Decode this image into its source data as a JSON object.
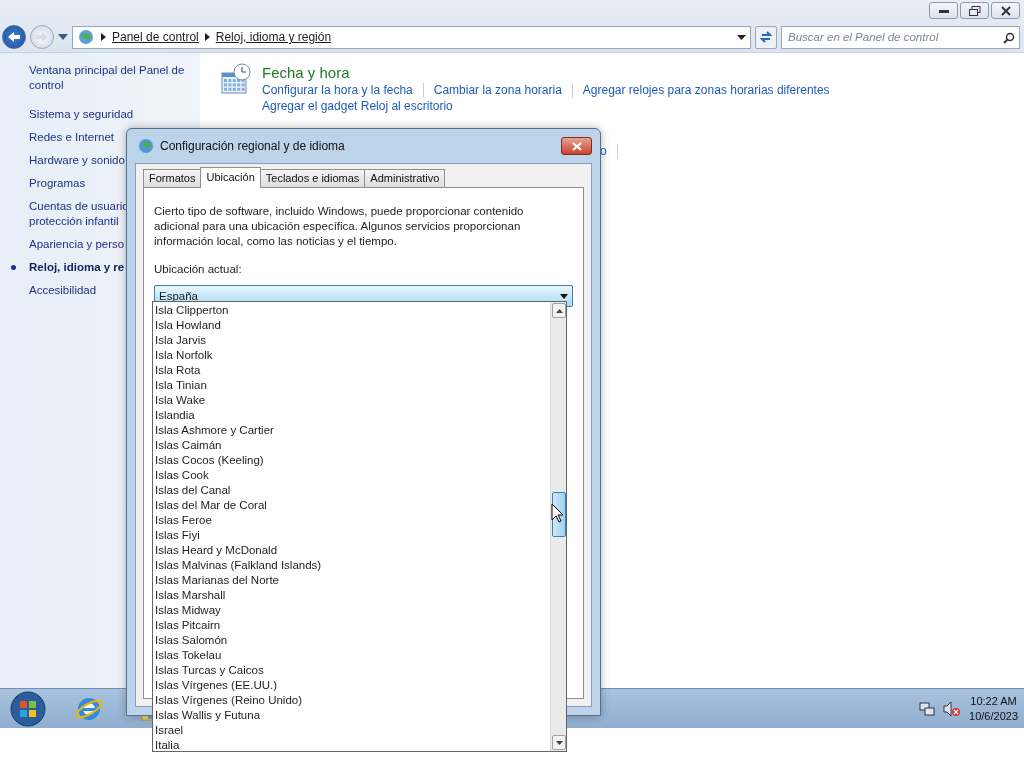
{
  "window": {
    "breadcrumb": [
      "Panel de control",
      "Reloj, idioma y región"
    ],
    "search": {
      "placeholder": "Buscar en el Panel de control"
    }
  },
  "sidebar": {
    "items": [
      {
        "lines": [
          "Ventana principal del Panel de",
          "control"
        ],
        "selected": false
      },
      {
        "lines": [
          "Sistema y seguridad"
        ],
        "selected": false
      },
      {
        "lines": [
          "Redes e Internet"
        ],
        "selected": false
      },
      {
        "lines": [
          "Hardware y sonido"
        ],
        "selected": false
      },
      {
        "lines": [
          "Programas"
        ],
        "selected": false
      },
      {
        "lines": [
          "Cuentas de usuario",
          "protección infantil"
        ],
        "selected": false
      },
      {
        "lines": [
          "Apariencia y perso"
        ],
        "selected": false
      },
      {
        "lines": [
          "Reloj, idioma y re"
        ],
        "selected": true
      },
      {
        "lines": [
          "Accesibilidad"
        ],
        "selected": false
      }
    ]
  },
  "sections": [
    {
      "title": "Fecha y hora",
      "links": [
        "Configurar la hora y la fecha",
        "Cambiar la zona horaria",
        "Agregar relojes para zonas horarias diferentes",
        "Agregar el gadget Reloj al escritorio"
      ]
    },
    {
      "links": [
        "o"
      ]
    }
  ],
  "dialog": {
    "title": "Configuración regional y de idioma",
    "tabs": [
      {
        "label": "Formatos",
        "selected": false
      },
      {
        "label": "Ubicación",
        "selected": true
      },
      {
        "label": "Teclados e idiomas",
        "selected": false
      },
      {
        "label": "Administrativo",
        "selected": false
      }
    ],
    "description": "Cierto tipo de software, incluido Windows, puede proporcionar contenido adicional para una ubicación específica. Algunos servicios proporcionan información local, como las noticias y el tiempo.",
    "location_label": "Ubicación actual:",
    "location_value": "España",
    "options": [
      "Isla Clipperton",
      "Isla Howland",
      "Isla Jarvis",
      "Isla Norfolk",
      "Isla Rota",
      "Isla Tinian",
      "Isla Wake",
      "Islandia",
      "Islas Ashmore y Cartier",
      "Islas Caimán",
      "Islas Cocos (Keeling)",
      "Islas Cook",
      "Islas del Canal",
      "Islas del Mar de Coral",
      "Islas Feroe",
      "Islas Fiyi",
      "Islas Heard y McDonald",
      "Islas Malvinas (Falkland Islands)",
      "Islas Marianas del Norte",
      "Islas Marshall",
      "Islas Midway",
      "Islas Pitcairn",
      "Islas Salomón",
      "Islas Tokelau",
      "Islas Turcas y Caicos",
      "Islas Vírgenes (EE.UU.)",
      "Islas Vírgenes (Reino Unido)",
      "Islas Wallis y Futuna",
      "Israel",
      "Italia"
    ]
  },
  "taskbar": {
    "clock": {
      "time": "10:22 AM",
      "date": "10/6/2023"
    }
  }
}
